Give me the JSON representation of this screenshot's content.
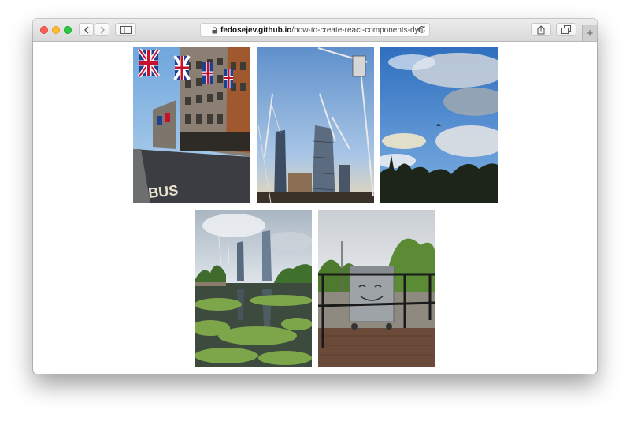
{
  "window": {
    "traffic_lights": [
      "close",
      "minimize",
      "zoom"
    ],
    "toolbar_buttons": {
      "back_icon": "chevron-left-icon",
      "forward_icon": "chevron-right-icon",
      "sidebar_icon": "sidebar-icon",
      "share_icon": "share-icon",
      "tabs_icon": "tabs-icon"
    },
    "new_tab_label": "+"
  },
  "address_bar": {
    "host": "fedosejev.github.io",
    "path": "/how-to-create-react-components-dyn",
    "secure": true
  },
  "gallery": {
    "photos": [
      {
        "subject": "street with union jack flags and bus lane",
        "overlay_text": "BUS"
      },
      {
        "subject": "skyscrapers and construction cranes"
      },
      {
        "subject": "cloudy blue sky over trees with plane"
      },
      {
        "subject": "canal with algae and city towers"
      },
      {
        "subject": "metal container with face drawn behind railing"
      }
    ]
  },
  "colors": {
    "close": "#fe5f57",
    "minimize": "#febc2e",
    "zoom": "#28c840",
    "toolbar": "#e2e2e2",
    "page_background": "#ffffff"
  }
}
